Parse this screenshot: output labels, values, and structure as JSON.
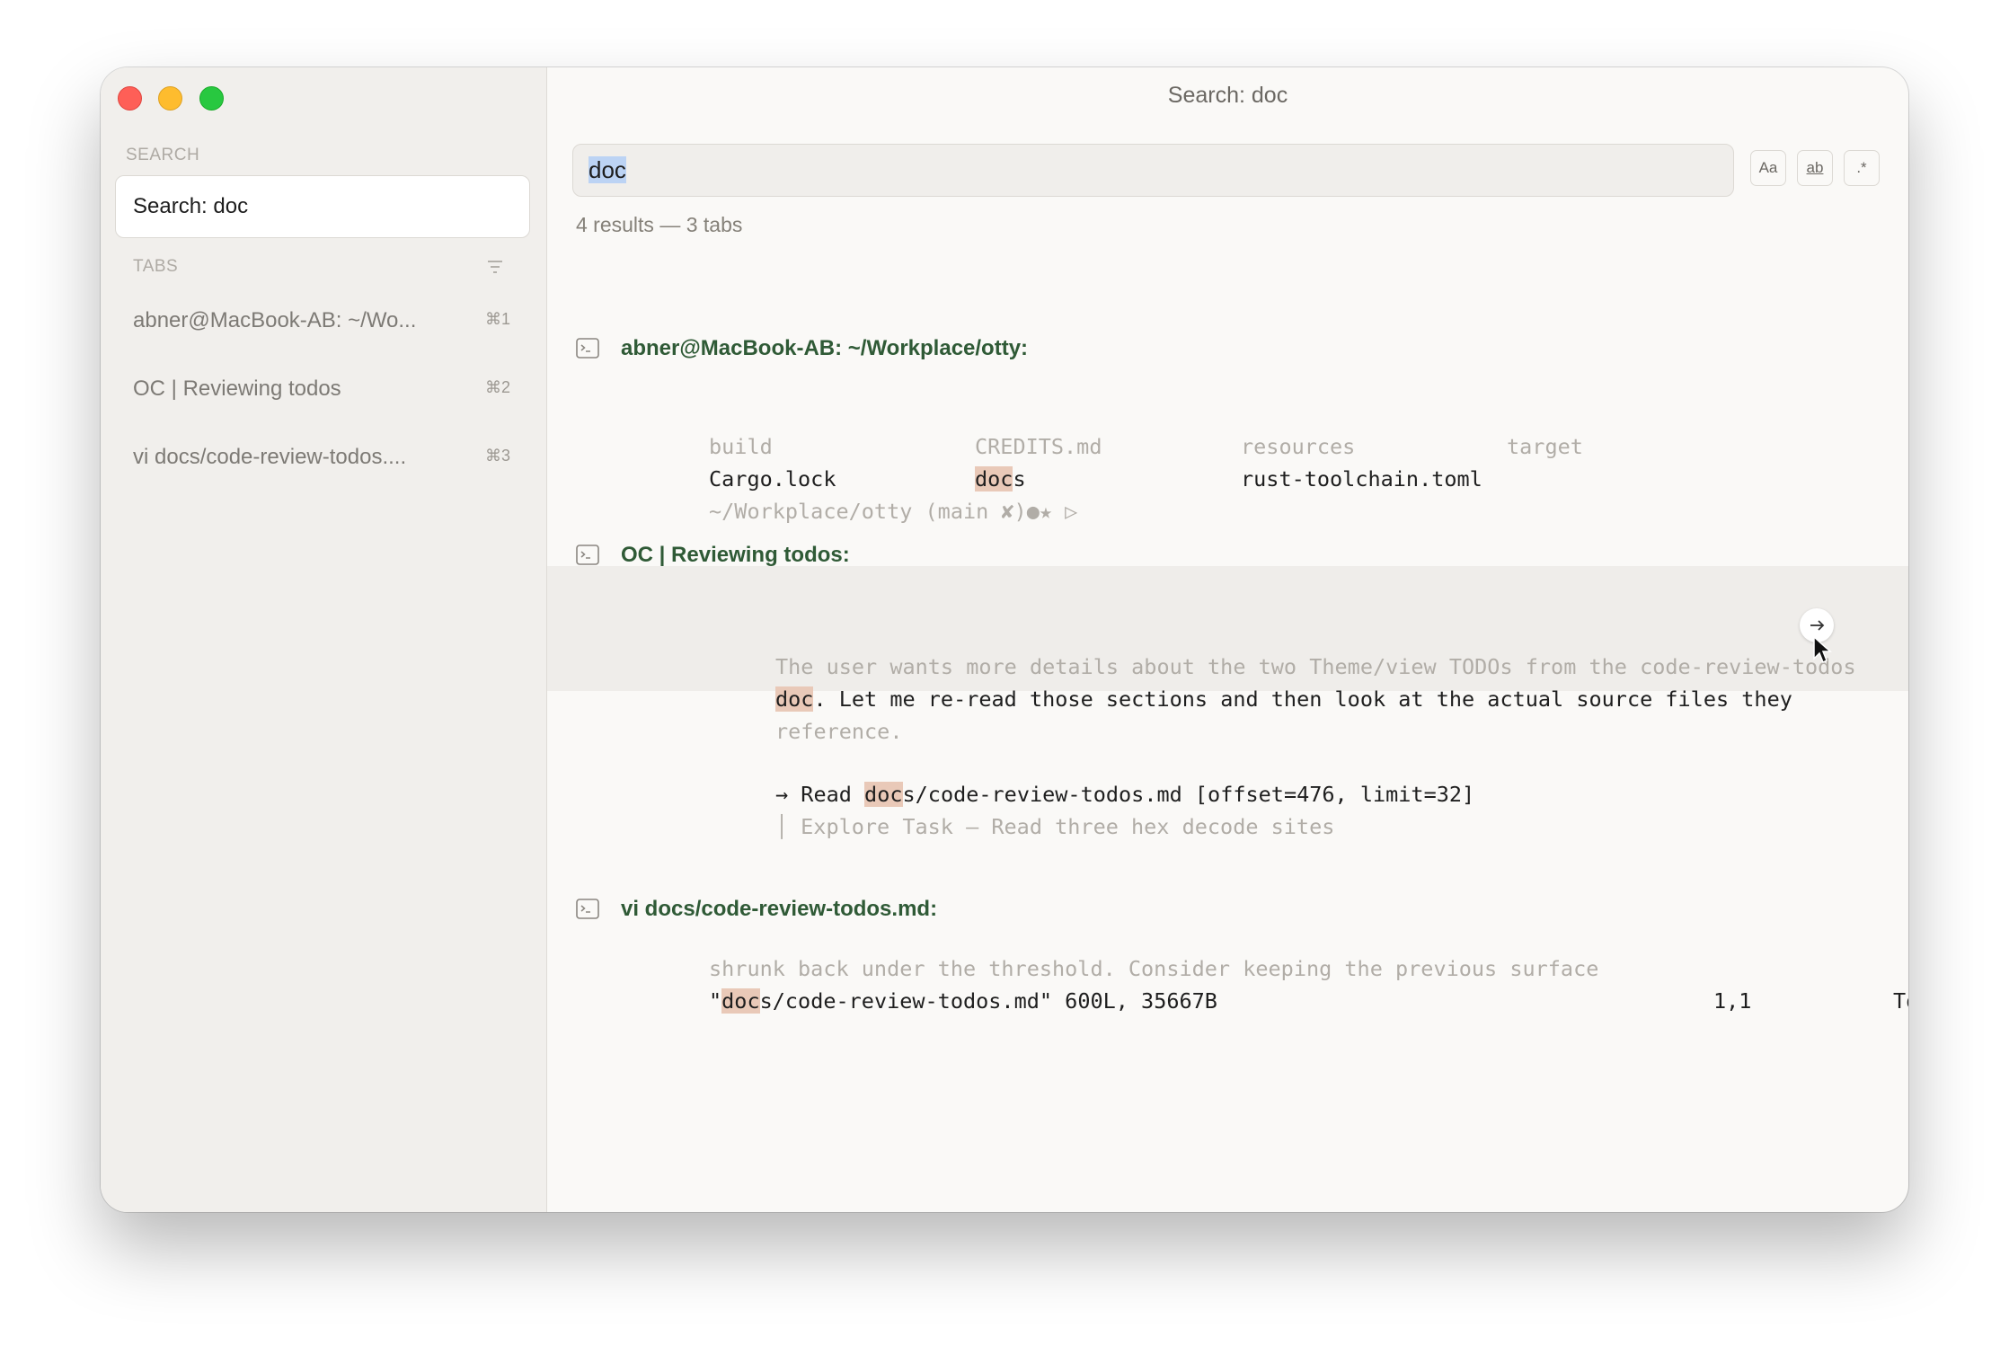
{
  "window": {
    "title": "Search: doc"
  },
  "sidebar": {
    "search_section_label": "SEARCH",
    "search_entry": "Search: doc",
    "tabs_section_label": "TABS",
    "tabs_filter_icon": "filter-lines-icon",
    "tabs": [
      {
        "label": "abner@MacBook-AB: ~/Wo...",
        "shortcut": "⌘1"
      },
      {
        "label": "OC | Reviewing todos",
        "shortcut": "⌘2"
      },
      {
        "label": "vi docs/code-review-todos....",
        "shortcut": "⌘3"
      }
    ]
  },
  "search": {
    "query": "doc",
    "options": [
      {
        "label": "Aa",
        "icon": "match-case-icon"
      },
      {
        "label": "ab",
        "icon": "whole-word-icon"
      },
      {
        "label": ".*",
        "icon": "regex-icon"
      }
    ],
    "summary": "4 results — 3 tabs"
  },
  "results": [
    {
      "title": "abner@MacBook-AB: ~/Workplace/otty:",
      "icon": "terminal-icon",
      "lines": {
        "r1c1": "build",
        "r1c2": "CREDITS.md",
        "r1c3": "resources",
        "r1c4": "target",
        "r2c1": "Cargo.lock",
        "r2c2_match": "doc",
        "r2c2_rest": "s",
        "r2c3": "rust-toolchain.toml",
        "prompt": "~/Workplace/otty (main ✘)●★ ▷"
      }
    },
    {
      "title": "OC | Reviewing todos:",
      "icon": "terminal-icon",
      "lines": {
        "l1": "The user wants more details about the two Theme/view TODOs from the code-review-todos",
        "l2_match": "doc",
        "l2_rest": ". Let me re-read those sections and then look at the actual source files they",
        "l3": "reference.",
        "l4_prefix": "→ Read ",
        "l4_match": "doc",
        "l4_rest": "s/code-review-todos.md [offset=476, limit=32]",
        "l5_bar": "│",
        "l5": "Explore Task — Read three hex decode sites"
      },
      "jump_icon": "arrow-right-icon"
    },
    {
      "title": "vi docs/code-review-todos.md:",
      "icon": "terminal-icon",
      "lines": {
        "l1": "shrunk back under the threshold. Consider keeping the previous surface",
        "l2_prefix": "\"",
        "l2_match": "doc",
        "l2_rest": "s/code-review-todos.md\" 600L, 35667B",
        "l2_pos": "1,1",
        "l2_scroll": "Top"
      }
    }
  ]
}
